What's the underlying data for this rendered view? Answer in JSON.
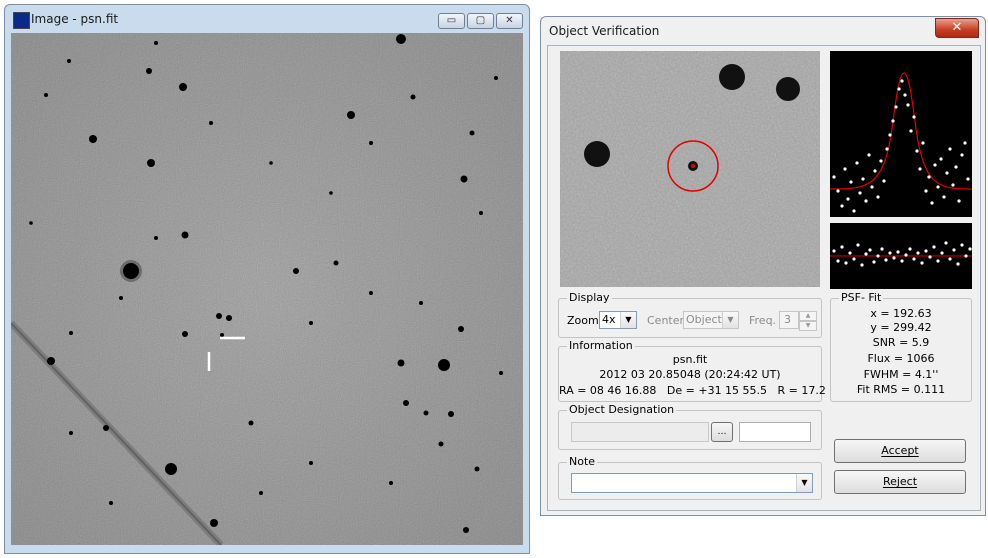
{
  "image_window": {
    "title": "Image - psn.fit",
    "controls": {
      "minimize": "▭",
      "maximize": "▢",
      "close": "✕"
    }
  },
  "verification_window": {
    "title": "Object Verification",
    "close": "✕",
    "display": {
      "legend": "Display",
      "zoom_label": "Zoom",
      "zoom_value": "4x",
      "center_label": "Center",
      "center_value": "Object",
      "freq_label": "Freq.",
      "freq_value": "3"
    },
    "psf_fit": {
      "legend": "PSF- Fit",
      "x": "x = 192.63",
      "y": "y = 299.42",
      "snr": "SNR = 5.9",
      "flux": "Flux = 1066",
      "fwhm": "FWHM = 4.1''",
      "fit_rms": "Fit RMS = 0.111"
    },
    "information": {
      "legend": "Information",
      "filename": "psn.fit",
      "date": "2012 03 20.85048 (20:24:42 UT)",
      "coords": "RA = 08 46 16.88   De = +31 15 55.5   R = 17.2"
    },
    "designation": {
      "legend": "Object Designation",
      "browse": "…",
      "name_value": "",
      "extra_value": ""
    },
    "note": {
      "legend": "Note",
      "value": ""
    },
    "accept_button": "Accept",
    "reject_button": "Reject"
  }
}
